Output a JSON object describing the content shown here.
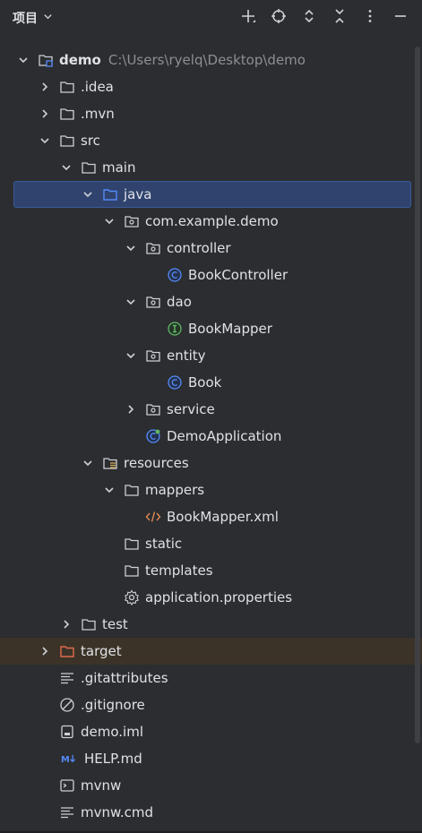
{
  "header": {
    "title": "项目"
  },
  "tree": [
    {
      "label": "demo",
      "path": "C:\\Users\\ryelq\\Desktop\\demo",
      "indent": 0,
      "arrow": "down",
      "icon": "module-folder",
      "bold": true
    },
    {
      "label": ".idea",
      "indent": 1,
      "arrow": "right",
      "icon": "folder"
    },
    {
      "label": ".mvn",
      "indent": 1,
      "arrow": "right",
      "icon": "folder"
    },
    {
      "label": "src",
      "indent": 1,
      "arrow": "down",
      "icon": "folder"
    },
    {
      "label": "main",
      "indent": 2,
      "arrow": "down",
      "icon": "folder"
    },
    {
      "label": "java",
      "indent": 3,
      "arrow": "down",
      "icon": "source-folder",
      "selected": true
    },
    {
      "label": "com.example.demo",
      "indent": 4,
      "arrow": "down",
      "icon": "package"
    },
    {
      "label": "controller",
      "indent": 5,
      "arrow": "down",
      "icon": "package"
    },
    {
      "label": "BookController",
      "indent": 6,
      "icon": "class"
    },
    {
      "label": "dao",
      "indent": 5,
      "arrow": "down",
      "icon": "package"
    },
    {
      "label": "BookMapper",
      "indent": 6,
      "icon": "interface"
    },
    {
      "label": "entity",
      "indent": 5,
      "arrow": "down",
      "icon": "package"
    },
    {
      "label": "Book",
      "indent": 6,
      "icon": "class"
    },
    {
      "label": "service",
      "indent": 5,
      "arrow": "right",
      "icon": "package"
    },
    {
      "label": "DemoApplication",
      "indent": 5,
      "icon": "spring-class"
    },
    {
      "label": "resources",
      "indent": 3,
      "arrow": "down",
      "icon": "resources-folder"
    },
    {
      "label": "mappers",
      "indent": 4,
      "arrow": "down",
      "icon": "folder"
    },
    {
      "label": "BookMapper.xml",
      "indent": 5,
      "icon": "xml"
    },
    {
      "label": "static",
      "indent": 4,
      "icon": "folder"
    },
    {
      "label": "templates",
      "indent": 4,
      "icon": "folder"
    },
    {
      "label": "application.properties",
      "indent": 4,
      "icon": "properties"
    },
    {
      "label": "test",
      "indent": 2,
      "arrow": "right",
      "icon": "folder"
    },
    {
      "label": "target",
      "indent": 1,
      "arrow": "right",
      "icon": "excluded-folder",
      "excluded": true
    },
    {
      "label": ".gitattributes",
      "indent": 1,
      "icon": "text"
    },
    {
      "label": ".gitignore",
      "indent": 1,
      "icon": "ignore"
    },
    {
      "label": "demo.iml",
      "indent": 1,
      "icon": "iml"
    },
    {
      "label": "HELP.md",
      "indent": 1,
      "icon": "markdown"
    },
    {
      "label": "mvnw",
      "indent": 1,
      "icon": "shell"
    },
    {
      "label": "mvnw.cmd",
      "indent": 1,
      "icon": "text"
    }
  ]
}
